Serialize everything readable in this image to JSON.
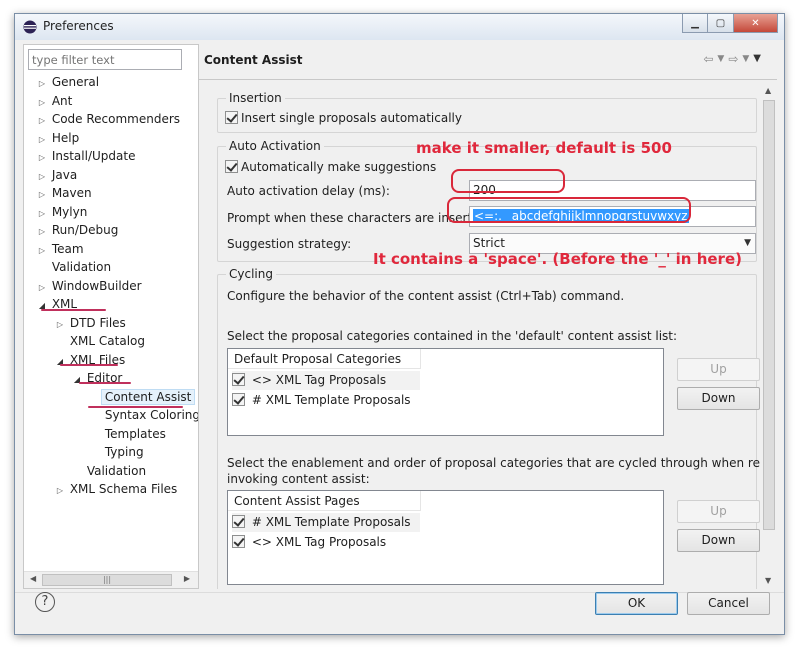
{
  "window": {
    "title": "Preferences"
  },
  "filter": {
    "placeholder": "type filter text"
  },
  "tree": [
    {
      "label": "General",
      "arrow": "▷"
    },
    {
      "label": "Ant",
      "arrow": "▷"
    },
    {
      "label": "Code Recommenders",
      "arrow": "▷"
    },
    {
      "label": "Help",
      "arrow": "▷"
    },
    {
      "label": "Install/Update",
      "arrow": "▷"
    },
    {
      "label": "Java",
      "arrow": "▷"
    },
    {
      "label": "Maven",
      "arrow": "▷"
    },
    {
      "label": "Mylyn",
      "arrow": "▷"
    },
    {
      "label": "Run/Debug",
      "arrow": "▷"
    },
    {
      "label": "Team",
      "arrow": "▷"
    },
    {
      "label": "Validation",
      "arrow": ""
    },
    {
      "label": "WindowBuilder",
      "arrow": "▷"
    },
    {
      "label": "XML",
      "arrow": "◢"
    },
    {
      "label": "DTD Files",
      "arrow": "▷"
    },
    {
      "label": "XML Catalog",
      "arrow": ""
    },
    {
      "label": "XML Files",
      "arrow": "◢"
    },
    {
      "label": "Editor",
      "arrow": "◢"
    },
    {
      "label": "Content Assist",
      "arrow": ""
    },
    {
      "label": "Syntax Coloring",
      "arrow": ""
    },
    {
      "label": "Templates",
      "arrow": ""
    },
    {
      "label": "Typing",
      "arrow": ""
    },
    {
      "label": "Validation",
      "arrow": ""
    },
    {
      "label": "XML Schema Files",
      "arrow": "▷"
    }
  ],
  "page": {
    "title": "Content Assist",
    "insertion": {
      "label": "Insertion",
      "single_proposals": "Insert single proposals automatically"
    },
    "auto_activation": {
      "label": "Auto Activation",
      "make_suggestions": "Automatically make suggestions",
      "delay_label": "Auto activation delay (ms):",
      "delay_value": "200",
      "prompt_label": "Prompt when these characters are inserted:",
      "prompt_value": "<=:. _abcdefghijklmnopqrstuvwxyz",
      "strategy_label": "Suggestion strategy:",
      "strategy_value": "Strict"
    },
    "cycling": {
      "label": "Cycling",
      "description": "Configure the behavior of the content assist (Ctrl+Tab) command.",
      "default_list_label": "Select the proposal categories contained in the 'default' content assist list:",
      "default_table_header": "Default Proposal Categories",
      "default_rows": [
        "<> XML Tag Proposals",
        "# XML Template Proposals"
      ],
      "cycled_label_1": "Select the enablement and order of proposal categories that are cycled through when repeatedly",
      "cycled_label_2": "invoking content assist:",
      "pages_table_header": "Content Assist Pages",
      "pages_rows": [
        "# XML Template Proposals",
        "<> XML Tag Proposals"
      ],
      "up_label": "Up",
      "down_label": "Down"
    }
  },
  "footer": {
    "help": "?",
    "ok": "OK",
    "cancel": "Cancel"
  },
  "annotations": {
    "delay_note": "make it smaller, default is 500",
    "space_note": "It contains a 'space'. (Before the '_' in here)"
  }
}
